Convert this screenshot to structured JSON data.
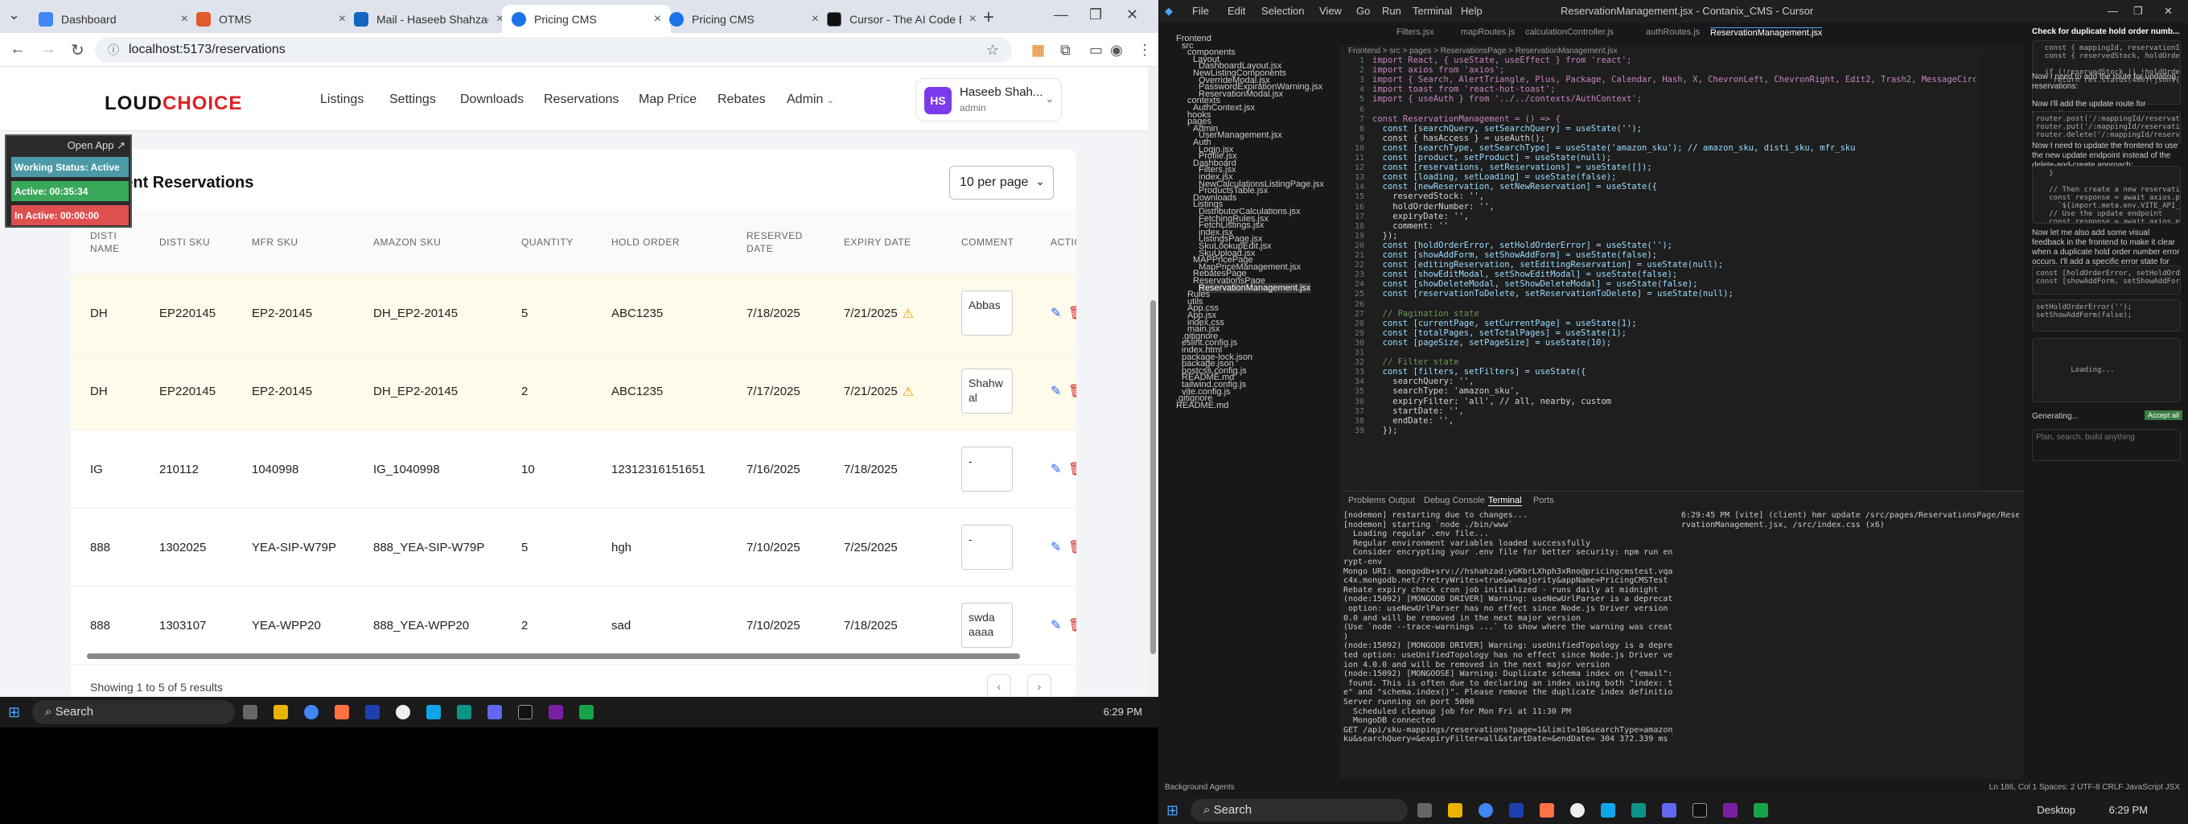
{
  "browser": {
    "tabs": [
      {
        "title": "Dashboard",
        "color": "#4285f4"
      },
      {
        "title": "OTMS",
        "color": "#e05a2b"
      },
      {
        "title": "Mail - Haseeb Shahzad -",
        "color": "#1565c0"
      },
      {
        "title": "Pricing CMS",
        "color": "#1a73e8"
      },
      {
        "title": "Pricing CMS",
        "color": "#1a73e8"
      },
      {
        "title": "Cursor - The AI Code Edi",
        "color": "#111111"
      }
    ],
    "url": "localhost:5173/reservations"
  },
  "app": {
    "logo_text": "LOUDCHOICE",
    "nav": [
      "Listings",
      "Settings",
      "Downloads",
      "Reservations",
      "Map Price",
      "Rebates",
      "Admin"
    ],
    "user": {
      "initials": "HS",
      "name": "Haseeb Shah...",
      "role": "admin"
    }
  },
  "widget": {
    "open_app": "Open App ↗",
    "status": "Working Status: Active",
    "active": "Active: 00:35:34",
    "inactive": "In Active: 00:00:00"
  },
  "reservations": {
    "title": "Current Reservations",
    "per_page": "10 per page",
    "columns": [
      "DISTI NAME",
      "DISTI SKU",
      "MFR SKU",
      "AMAZON SKU",
      "QUANTITY",
      "HOLD ORDER",
      "RESERVED DATE",
      "EXPIRY DATE",
      "COMMENT",
      "ACTIONS"
    ],
    "rows": [
      {
        "disti": "DH",
        "disti_sku": "EP220145",
        "mfr_sku": "EP2-20145",
        "amazon_sku": "DH_EP2-20145",
        "qty": "5",
        "hold": "ABC1235",
        "reserved": "7/18/2025",
        "expiry": "7/21/2025",
        "warn": true,
        "comment": "Abbas"
      },
      {
        "disti": "DH",
        "disti_sku": "EP220145",
        "mfr_sku": "EP2-20145",
        "amazon_sku": "DH_EP2-20145",
        "qty": "2",
        "hold": "ABC1235",
        "reserved": "7/17/2025",
        "expiry": "7/21/2025",
        "warn": true,
        "comment": "Shahw al"
      },
      {
        "disti": "IG",
        "disti_sku": "210112",
        "mfr_sku": "1040998",
        "amazon_sku": "IG_1040998",
        "qty": "10",
        "hold": "12312316151651",
        "reserved": "7/16/2025",
        "expiry": "7/18/2025",
        "warn": false,
        "comment": "-"
      },
      {
        "disti": "888",
        "disti_sku": "1302025",
        "mfr_sku": "YEA-SIP-W79P",
        "amazon_sku": "888_YEA-SIP-W79P",
        "qty": "5",
        "hold": "hgh",
        "reserved": "7/10/2025",
        "expiry": "7/25/2025",
        "warn": false,
        "comment": "-"
      },
      {
        "disti": "888",
        "disti_sku": "1303107",
        "mfr_sku": "YEA-WPP20",
        "amazon_sku": "888_YEA-WPP20",
        "qty": "2",
        "hold": "sad",
        "reserved": "7/10/2025",
        "expiry": "7/18/2025",
        "warn": false,
        "comment": "swda aaaa"
      }
    ],
    "footer": "Showing 1 to 5 of 5 results"
  },
  "taskbar_left": {
    "search": "Search",
    "time": "6:29 PM"
  },
  "vscode": {
    "title": "ReservationManagement.jsx - Contanix_CMS - Cursor",
    "menus": [
      "File",
      "Edit",
      "Selection",
      "View",
      "Go",
      "Run",
      "Terminal",
      "Help"
    ],
    "tabs": [
      "Filters.jsx",
      "mapRoutes.js",
      "calculationController.js",
      "authRoutes.js",
      "ReservationManagement.jsx"
    ],
    "breadcrumb": "Frontend > src > pages > ReservationsPage > ReservationManagement.jsx",
    "tree": [
      "Frontend",
      "src",
      "components",
      "Layout",
      "DashboardLayout.jsx",
      "NewListingComponents",
      "OverrideModal.jsx",
      "PasswordExpirationWarning.jsx",
      "ReservationModal.jsx",
      "contexts",
      "AuthContext.jsx",
      "hooks",
      "pages",
      "Admin",
      "UserManagement.jsx",
      "Auth",
      "Login.jsx",
      "Profile.jsx",
      "Dashboard",
      "Filters.jsx",
      "index.jsx",
      "NewCalculationsListingPage.jsx",
      "ProductsTable.jsx",
      "Downloads",
      "Listings",
      "DistributorCalculations.jsx",
      "FetchingRules.jsx",
      "FetchListings.jsx",
      "index.jsx",
      "ListingsPage.jsx",
      "SkuLookupEdit.jsx",
      "SkuUpload.jsx",
      "MAPPricePage",
      "MapPriceManagement.jsx",
      "RebatesPage",
      "ReservationsPage",
      "ReservationManagement.jsx",
      "Rules",
      "utils",
      "App.css",
      "App.jsx",
      "index.css",
      "main.jsx",
      ".gitignore",
      "eslint.config.js",
      "index.html",
      "package-lock.json",
      "package.json",
      "postcss.config.js",
      "README.md",
      "tailwind.config.js",
      "vite.config.js",
      ".gitignore",
      "README.md"
    ],
    "code": [
      "import React, { useState, useEffect } from 'react';",
      "import axios from 'axios';",
      "import { Search, AlertTriangle, Plus, Package, Calendar, Hash, X, ChevronLeft, ChevronRight, Edit2, Trash2, MessageCircle }",
      "import toast from 'react-hot-toast';",
      "import { useAuth } from '../../contexts/AuthContext';",
      "",
      "const ReservationManagement = () => {",
      "  const [searchQuery, setSearchQuery] = useState('');",
      "  const { hasAccess } = useAuth();",
      "  const [searchType, setSearchType] = useState('amazon_sku'); // amazon_sku, disti_sku, mfr_sku",
      "  const [product, setProduct] = useState(null);",
      "  const [reservations, setReservations] = useState([]);",
      "  const [loading, setLoading] = useState(false);",
      "  const [newReservation, setNewReservation] = useState({",
      "    reservedStock: '',",
      "    holdOrderNumber: '',",
      "    expiryDate: '',",
      "    comment: ''",
      "  });",
      "  const [holdOrderError, setHoldOrderError] = useState('');",
      "  const [showAddForm, setShowAddForm] = useState(false);",
      "  const [editingReservation, setEditingReservation] = useState(null);",
      "  const [showEditModal, setShowEditModal] = useState(false);",
      "  const [showDeleteModal, setShowDeleteModal] = useState(false);",
      "  const [reservationToDelete, setReservationToDelete] = useState(null);",
      "",
      "  // Pagination state",
      "  const [currentPage, setCurrentPage] = useState(1);",
      "  const [totalPages, setTotalPages] = useState(1);",
      "  const [pageSize, setPageSize] = useState(10);",
      "",
      "  // Filter state",
      "  const [filters, setFilters] = useState({",
      "    searchQuery: '',",
      "    searchType: 'amazon_sku',",
      "    expiryFilter: 'all', // all, nearby, custom",
      "    startDate: '',",
      "    endDate: '',",
      "  });"
    ],
    "panel_tabs": [
      "Problems",
      "Output",
      "Debug Console",
      "Terminal",
      "Ports"
    ],
    "terminal_left": [
      "[nodemon] restarting due to changes...",
      "[nodemon] starting `node ./bin/www`",
      "  Loading regular .env file...",
      "  Regular environment variables loaded successfully",
      "  Consider encrypting your .env file for better security: npm run enc",
      "rypt-env",
      "Mongo URI: mongodb+srv://hshahzad:yGKbrLXhph3xRno@pricingcmstest.vqac",
      "c4x.mongodb.net/?retryWrites=true&w=majority&appName=PricingCMSTest",
      "Rebate expiry check cron job initialized - runs daily at midnight",
      "(node:15092) [MONGODB DRIVER] Warning: useNewUrlParser is a deprecated",
      " option: useNewUrlParser has no effect since Node.js Driver version 4.",
      "0.0 and will be removed in the next major version",
      "(Use `node --trace-warnings ...` to show where the warning was created",
      ")",
      "(node:15092) [MONGODB DRIVER] Warning: useUnifiedTopology is a depreca",
      "ted option: useUnifiedTopology has no effect since Node.js Driver vers",
      "ion 4.0.0 and will be removed in the next major version",
      "(node:15092) [MONGOOSE] Warning: Duplicate schema index on {\"email\":1}",
      " found. This is often due to declaring an index using both \"index: tru",
      "e\" and \"schema.index()\". Please remove the duplicate index definition.",
      "Server running on port 5000",
      "  Scheduled cleanup job for Mon Fri at 11:30 PM",
      "  MongoDB connected",
      "GET /api/sku-mappings/reservations?page=1&limit=10&searchType=amazon_s",
      "ku&searchQuery=&expiryFilter=all&startDate=&endDate= 304 372.339 ms -"
    ],
    "terminal_right": [
      "6:29:45 PM [vite] (client) hmr update /src/pages/ReservationsPage/Rese",
      "rvationManagement.jsx, /src/index.css (x6)"
    ],
    "chat": {
      "header": "Check for duplicate hold order numb...",
      "p1": "Now I need to add the route for updating reservations:",
      "p2": "Now I'll add the update route for reservations:",
      "p3": "Now I need to update the frontend to use the new update endpoint instead of the delete-and-create approach:",
      "p4": "Now let me also add some visual feedback in the frontend to make it clear when a duplicate hold order number error occurs. I'll add a specific error state for the hold order number field:",
      "loading": "Loading...",
      "generating": "Generating...",
      "accept": "Accept all",
      "input_placeholder": "Plan, search, build anything"
    },
    "status_left": "Background Agents",
    "status_right": "Ln 186, Col 1   Spaces: 2   UTF-8   CRLF   JavaScript JSX"
  },
  "taskbar_right": {
    "search": "Search",
    "time": "6:29 PM",
    "desktop": "Desktop"
  }
}
